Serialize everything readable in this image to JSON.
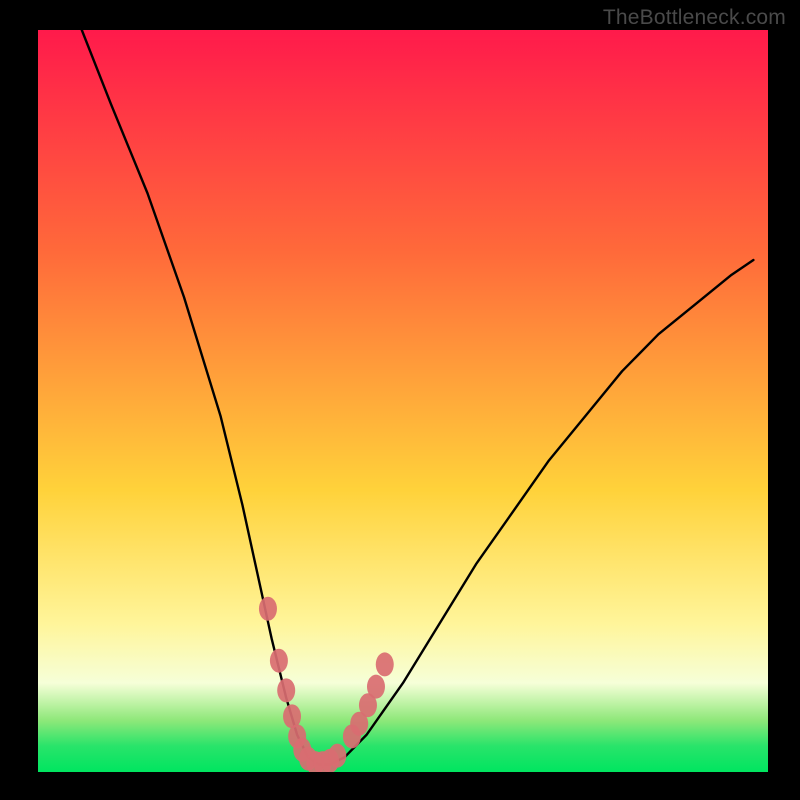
{
  "watermark": "TheBottleneck.com",
  "colors": {
    "frame": "#000000",
    "curve": "#000000",
    "marker_fill": "#d96c71",
    "marker_stroke": "#d96c71",
    "grad_top": "#ff1a4b",
    "grad_mid1": "#ff6a3a",
    "grad_mid2": "#ffd23a",
    "grad_band": "#fff59a",
    "grad_green1": "#8fe87a",
    "grad_green2": "#29e46a",
    "grad_bottom": "#00e560"
  },
  "chart_data": {
    "type": "line",
    "title": "",
    "xlabel": "",
    "ylabel": "",
    "x_range": [
      0,
      100
    ],
    "y_range": [
      0,
      100
    ],
    "note": "Axes have no numeric tick labels in the image; x/y values are estimated as percentages of the plot area (0–100).",
    "series": [
      {
        "name": "bottleneck-curve",
        "x": [
          6,
          10,
          15,
          20,
          25,
          28,
          30,
          32,
          34,
          35.5,
          37,
          38.5,
          40,
          42,
          45,
          50,
          55,
          60,
          65,
          70,
          75,
          80,
          85,
          90,
          95,
          98
        ],
        "y": [
          100,
          90,
          78,
          64,
          48,
          36,
          27,
          18,
          10,
          5,
          2,
          1,
          1,
          2,
          5,
          12,
          20,
          28,
          35,
          42,
          48,
          54,
          59,
          63,
          67,
          69
        ]
      }
    ],
    "markers": {
      "name": "highlighted-points",
      "points": [
        {
          "x": 31.5,
          "y": 22
        },
        {
          "x": 33.0,
          "y": 15
        },
        {
          "x": 34.0,
          "y": 11
        },
        {
          "x": 34.8,
          "y": 7.5
        },
        {
          "x": 35.5,
          "y": 4.8
        },
        {
          "x": 36.2,
          "y": 3.0
        },
        {
          "x": 37.0,
          "y": 1.8
        },
        {
          "x": 38.0,
          "y": 1.2
        },
        {
          "x": 39.0,
          "y": 1.2
        },
        {
          "x": 40.0,
          "y": 1.5
        },
        {
          "x": 41.0,
          "y": 2.2
        },
        {
          "x": 43.0,
          "y": 4.8
        },
        {
          "x": 44.0,
          "y": 6.5
        },
        {
          "x": 45.2,
          "y": 9.0
        },
        {
          "x": 46.3,
          "y": 11.5
        },
        {
          "x": 47.5,
          "y": 14.5
        }
      ]
    },
    "background_gradient_stops": [
      {
        "offset": 0.0,
        "color": "#ff1a4b"
      },
      {
        "offset": 0.3,
        "color": "#ff6a3a"
      },
      {
        "offset": 0.62,
        "color": "#ffd23a"
      },
      {
        "offset": 0.8,
        "color": "#fff59a"
      },
      {
        "offset": 0.88,
        "color": "#f6ffd8"
      },
      {
        "offset": 0.93,
        "color": "#8fe87a"
      },
      {
        "offset": 0.965,
        "color": "#29e46a"
      },
      {
        "offset": 1.0,
        "color": "#00e560"
      }
    ]
  }
}
